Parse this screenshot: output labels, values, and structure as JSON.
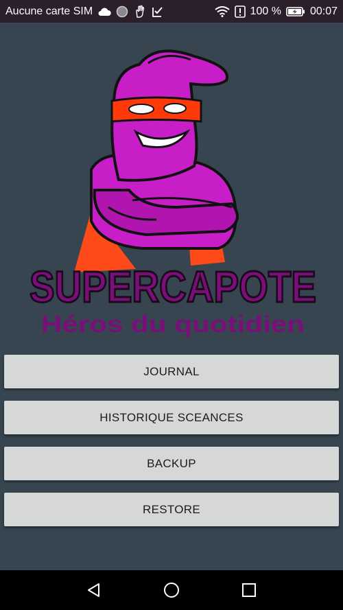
{
  "status_bar": {
    "carrier": "Aucune carte SIM",
    "battery_percent": "100 %",
    "time": "00:07",
    "icons": [
      "cloud-icon",
      "circle-icon",
      "hand-icon",
      "checklist-icon",
      "wifi-icon",
      "alert-icon",
      "battery-charging-icon"
    ]
  },
  "logo": {
    "title": "SUPERCAPOTE",
    "subtitle": "Héros du quotidien",
    "colors": {
      "primary": "#c81ec8",
      "text": "#7a0f7a",
      "cape": "#ff4a1a",
      "mask": "#ff3a0a"
    }
  },
  "menu": {
    "buttons": [
      {
        "label": "JOURNAL"
      },
      {
        "label": "HISTORIQUE SCEANCES"
      },
      {
        "label": "BACKUP"
      },
      {
        "label": "RESTORE"
      }
    ]
  },
  "nav": {
    "icons": [
      "back-icon",
      "home-icon",
      "recents-icon"
    ]
  },
  "theme": {
    "background": "#36454f",
    "button_bg": "#d6d7d7",
    "status_bg": "#2b1f2b"
  }
}
